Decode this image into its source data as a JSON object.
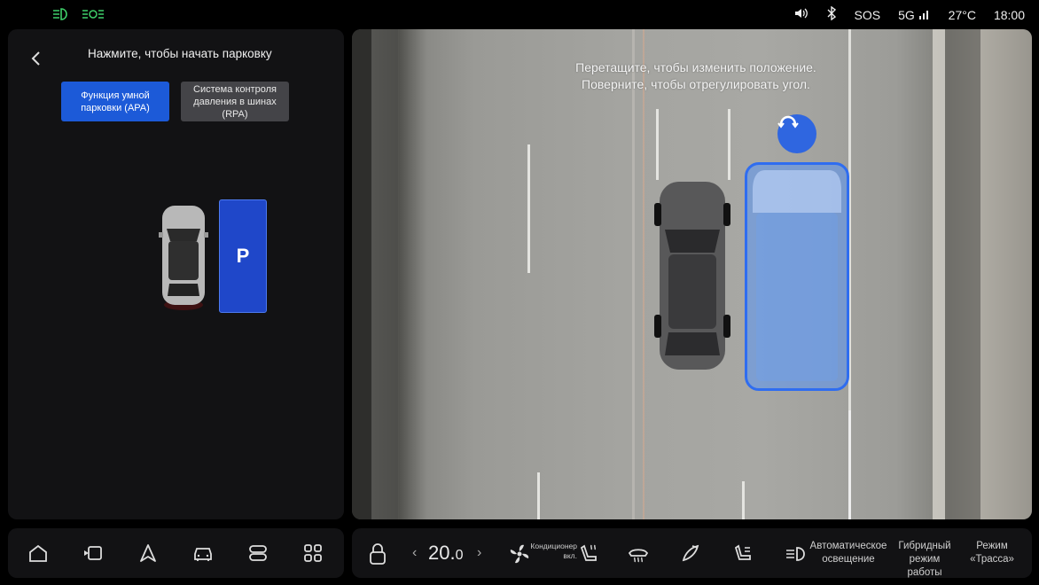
{
  "status_bar": {
    "icons_left": [
      "low-beam-icon",
      "parking-lights-icon"
    ],
    "sos": "SOS",
    "network": "5G",
    "temperature": "27°C",
    "time": "18:00"
  },
  "left_panel": {
    "title": "Нажмите, чтобы начать парковку",
    "modes": [
      {
        "label": "Функция умной парковки (APA)",
        "selected": true
      },
      {
        "label": "Система контроля давления в шинах (RPA)",
        "selected": false
      }
    ],
    "parking_slot_label": "P"
  },
  "camera_view": {
    "hint_line1": "Перетащите, чтобы изменить положение.",
    "hint_line2": "Поверните, чтобы отрегулировать угол."
  },
  "dock": {
    "nav_icons": [
      "home-icon",
      "media-icon",
      "navigation-icon",
      "vehicle-icon",
      "apps-toggle-icon",
      "grid-menu-icon"
    ],
    "temperature_main": "20.",
    "temperature_decimal": "0",
    "ac_label": "Кондиционер вкл.",
    "auto_lighting": "Автоматическое освещение",
    "hybrid_mode": "Гибридный режим работы",
    "track_mode": "Режим «Трасса»"
  },
  "colors": {
    "accent": "#1c5ad8",
    "slot": "#1f47c9",
    "panel": "#121214"
  }
}
